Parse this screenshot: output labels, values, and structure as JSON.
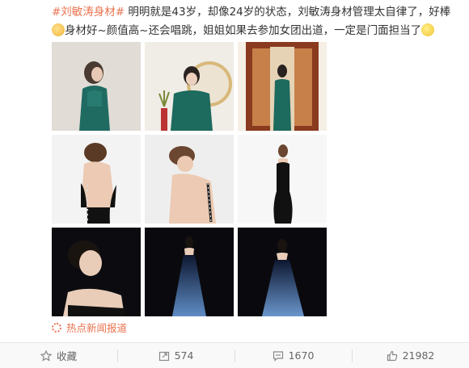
{
  "post": {
    "hashtag": "#刘敏涛身材#",
    "text_line1": " 明明就是43岁，却像24岁的状态，刘敏涛身材管理太自律了，好棒",
    "text_line2": "身材好~颜值高~还会唱跳，姐姐如果去参加女团出道，一定是门面担当了",
    "emoji_start": "thumb-up-emoji",
    "emoji_end": "laugh-emoji"
  },
  "photos": [
    {
      "name": "photo-1",
      "desc": "green sequin dress back view"
    },
    {
      "name": "photo-2",
      "desc": "green sequin dress with round mirror"
    },
    {
      "name": "photo-3",
      "desc": "green sequin dress in doorway"
    },
    {
      "name": "photo-4",
      "desc": "black backless dress"
    },
    {
      "name": "photo-5",
      "desc": "backless dress portrait"
    },
    {
      "name": "photo-6",
      "desc": "black halter dress full length"
    },
    {
      "name": "photo-7",
      "desc": "smiling portrait on dark background"
    },
    {
      "name": "photo-8",
      "desc": "blue ombre gown dark background"
    },
    {
      "name": "photo-9",
      "desc": "blue ombre gown dark background"
    }
  ],
  "source": {
    "label": "热点新闻报道",
    "icon": "news-flower-icon"
  },
  "actions": {
    "favorite": "收藏",
    "repost": "574",
    "comment": "1670",
    "like": "21982"
  },
  "colors": {
    "accent": "#eb7350",
    "text": "#333333",
    "muted": "#666666"
  }
}
